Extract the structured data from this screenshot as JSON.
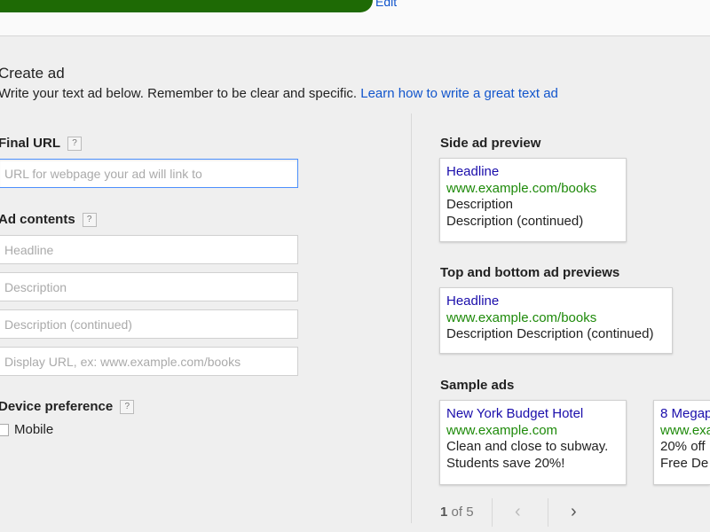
{
  "header": {
    "edit_label": "Edit"
  },
  "create_ad": {
    "title": "Create ad",
    "intro_text": "Write your text ad below. Remember to be clear and specific.",
    "learn_link": "Learn how to write a great text ad"
  },
  "form": {
    "final_url": {
      "label": "Final URL",
      "help": "?",
      "placeholder": "URL for webpage your ad will link to"
    },
    "ad_contents": {
      "label": "Ad contents",
      "help": "?",
      "headline_placeholder": "Headline",
      "description_placeholder": "Description",
      "description2_placeholder": "Description (continued)",
      "display_url_placeholder": "Display URL, ex: www.example.com/books"
    },
    "device_preference": {
      "label": "Device preference",
      "help": "?",
      "mobile_label": "Mobile",
      "mobile_checked": false
    }
  },
  "side_preview": {
    "title": "Side ad preview",
    "headline": "Headline",
    "url": "www.example.com/books",
    "desc1": "Description",
    "desc2": "Description (continued)"
  },
  "top_bottom_preview": {
    "title": "Top and bottom ad previews",
    "headline": "Headline",
    "url": "www.example.com/books",
    "desc": "Description Description (continued)"
  },
  "sample_ads": {
    "title": "Sample ads",
    "ads": [
      {
        "headline": "New York Budget Hotel",
        "url": "www.example.com",
        "desc1": "Clean and close to subway.",
        "desc2": "Students save 20%!"
      },
      {
        "headline": "8 Megap",
        "url": "www.exa",
        "desc1": "20% off",
        "desc2": "Free De"
      }
    ],
    "pager": {
      "current": "1",
      "of_text": "of 5",
      "prev_icon": "‹",
      "next_icon": "›"
    }
  },
  "colors": {
    "brand_green": "#1e6a05",
    "link_blue": "#1155cc",
    "ad_headline": "#1a0dab",
    "ad_url": "#1e8a0a"
  }
}
